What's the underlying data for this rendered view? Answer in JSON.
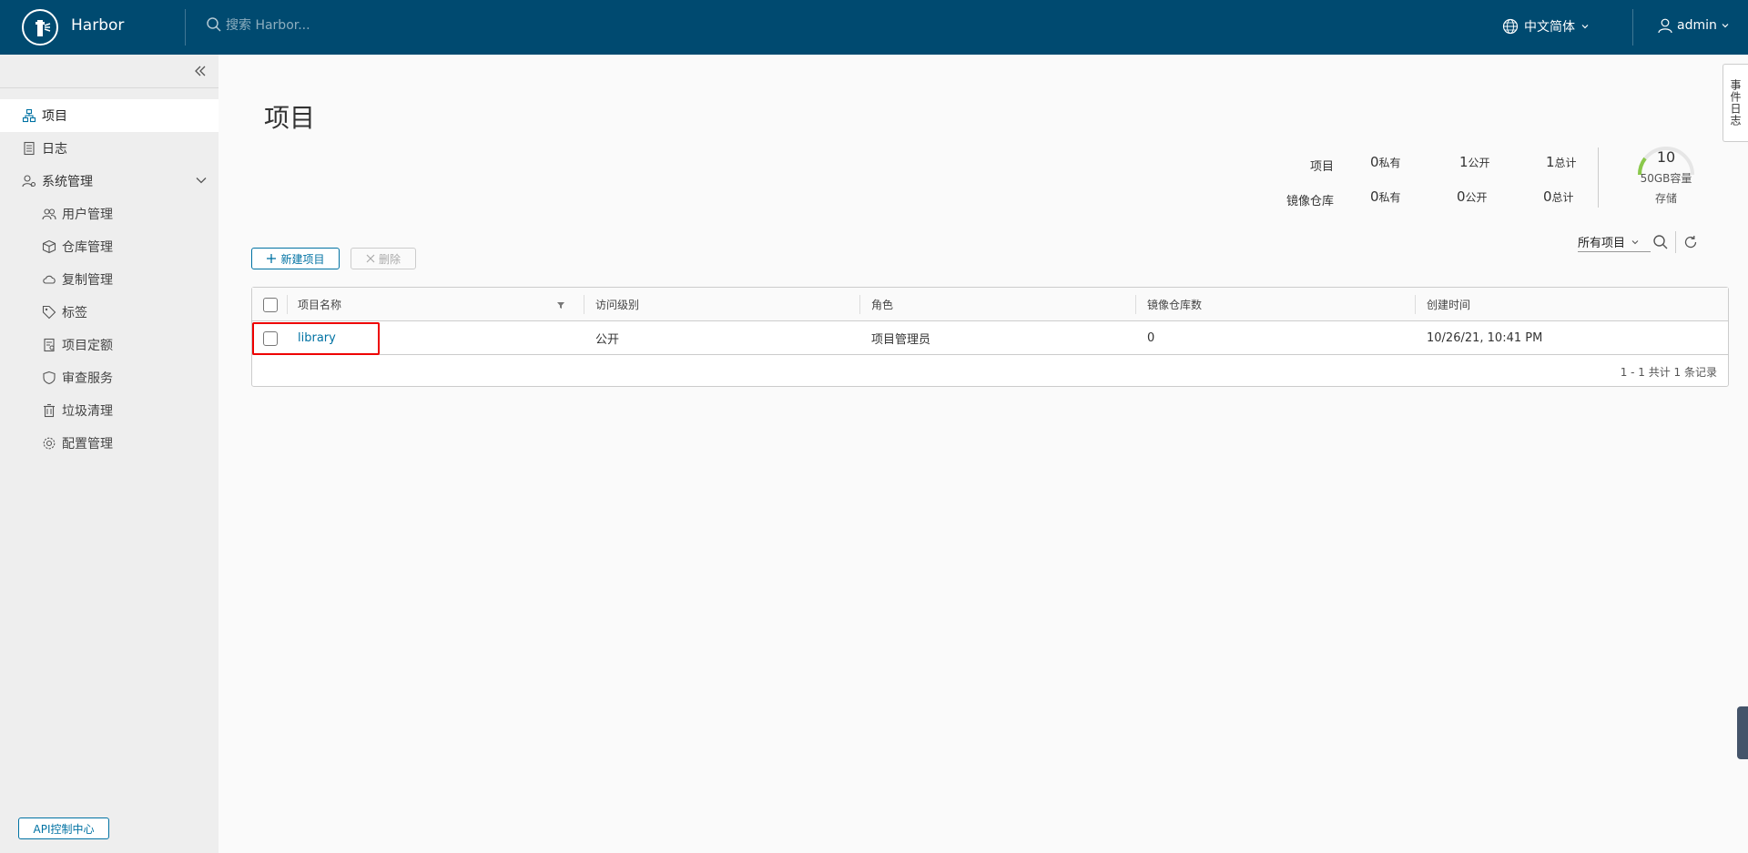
{
  "header": {
    "brand": "Harbor",
    "search_placeholder": "搜索 Harbor...",
    "language": "中文简体",
    "user": "admin"
  },
  "sidebar": {
    "items": [
      {
        "label": "项目",
        "icon": "projects-icon",
        "active": true
      },
      {
        "label": "日志",
        "icon": "logs-icon"
      },
      {
        "label": "系统管理",
        "icon": "admin-icon",
        "expanded": true
      },
      {
        "label": "用户管理",
        "icon": "users-icon"
      },
      {
        "label": "仓库管理",
        "icon": "registry-icon"
      },
      {
        "label": "复制管理",
        "icon": "replication-icon"
      },
      {
        "label": "标签",
        "icon": "tag-icon"
      },
      {
        "label": "项目定额",
        "icon": "quota-icon"
      },
      {
        "label": "审查服务",
        "icon": "shield-icon"
      },
      {
        "label": "垃圾清理",
        "icon": "trash-icon"
      },
      {
        "label": "配置管理",
        "icon": "gear-icon"
      }
    ],
    "api_button": "API控制中心"
  },
  "main": {
    "title": "项目",
    "stats": {
      "projects_label": "项目",
      "repos_label": "镜像仓库",
      "projects_private": "0",
      "projects_public": "1",
      "projects_total": "1",
      "repos_private": "0",
      "repos_public": "0",
      "repos_total": "0",
      "private_suffix": "私有",
      "public_suffix": "公开",
      "total_suffix": "总计",
      "storage_value": "10",
      "storage_capacity": "50GB容量",
      "storage_label": "存储"
    },
    "toolbar": {
      "new_project": "新建项目",
      "delete": "删除",
      "filter_value": "所有项目"
    },
    "table": {
      "columns": [
        "项目名称",
        "访问级别",
        "角色",
        "镜像仓库数",
        "创建时间"
      ],
      "rows": [
        {
          "name": "library",
          "access": "公开",
          "role": "项目管理员",
          "repo_count": "0",
          "created": "10/26/21, 10:41 PM"
        }
      ],
      "footer": "1 - 1 共计 1 条记录"
    }
  },
  "side_tab": "事件日志",
  "colors": {
    "header_bg": "#004a70",
    "accent": "#0072a3",
    "highlight": "#ee0000"
  }
}
